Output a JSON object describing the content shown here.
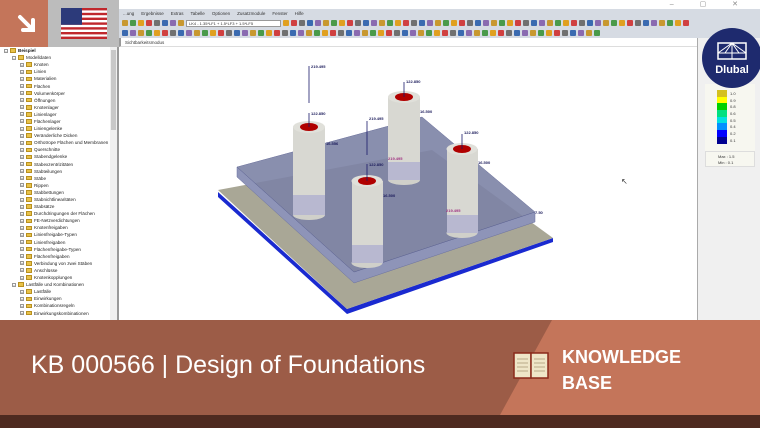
{
  "menu": [
    "...ung",
    "Ergebnisse",
    "Extras",
    "Tabelle",
    "Optionen",
    "Zusatzmodule",
    "Fenster",
    "Hilfe"
  ],
  "window_controls": "– ▢ ✕",
  "load_combo": "LK4 - 1.35*LF1 + 1.5*LF3 + 1.5*LF5",
  "view_mode": "Sichtbarkeitsmodus",
  "tree": [
    {
      "label": "Beispiel",
      "level": 0,
      "bold": true
    },
    {
      "label": "Modelldaten",
      "level": 1
    },
    {
      "label": "Knoten",
      "level": 2
    },
    {
      "label": "Linien",
      "level": 2
    },
    {
      "label": "Materialien",
      "level": 2
    },
    {
      "label": "Flächen",
      "level": 2
    },
    {
      "label": "Volumenkörper",
      "level": 2
    },
    {
      "label": "Öffnungen",
      "level": 2
    },
    {
      "label": "Knotenlager",
      "level": 2
    },
    {
      "label": "Linienlager",
      "level": 2
    },
    {
      "label": "Flächenlager",
      "level": 2
    },
    {
      "label": "Liniengelenke",
      "level": 2
    },
    {
      "label": "Veränderliche Dicken",
      "level": 2
    },
    {
      "label": "Orthotrope Flächen und Membranen",
      "level": 2
    },
    {
      "label": "Querschnitte",
      "level": 2
    },
    {
      "label": "Stabendgelenke",
      "level": 2
    },
    {
      "label": "Stabexzentrizitäten",
      "level": 2
    },
    {
      "label": "Stabteilungen",
      "level": 2
    },
    {
      "label": "Stäbe",
      "level": 2
    },
    {
      "label": "Rippen",
      "level": 2
    },
    {
      "label": "Stabbettungen",
      "level": 2
    },
    {
      "label": "Stabnichtlinearitäten",
      "level": 2
    },
    {
      "label": "Stabsätze",
      "level": 2
    },
    {
      "label": "Durchdringungen der Flächen",
      "level": 2
    },
    {
      "label": "FE-Netzverdichtungen",
      "level": 2
    },
    {
      "label": "Knotenfreigaben",
      "level": 2
    },
    {
      "label": "Linienfreigabe-Typen",
      "level": 2
    },
    {
      "label": "Linienfreigaben",
      "level": 2
    },
    {
      "label": "Flächenfreigabe-Typen",
      "level": 2
    },
    {
      "label": "Flächenfreigaben",
      "level": 2
    },
    {
      "label": "Verbindung von zwei Stäben",
      "level": 2
    },
    {
      "label": "Anschlüsse",
      "level": 2
    },
    {
      "label": "Knotenkopplungen",
      "level": 2
    },
    {
      "label": "Lastfälle und Kombinationen",
      "level": 1
    },
    {
      "label": "Lastfälle",
      "level": 2
    },
    {
      "label": "Einwirkungen",
      "level": 2
    },
    {
      "label": "Kombinationsregeln",
      "level": 2
    },
    {
      "label": "Einwirkungskombinationen",
      "level": 2
    }
  ],
  "model_labels": {
    "load_top": "219.495",
    "col1": "122.850",
    "col2": "122.850",
    "col3": "122.850",
    "col4": "122.850",
    "mid_load": "219.495",
    "dim1": "16.556",
    "dim2": "16.500",
    "dim3": "16.500",
    "dim4": "16.500",
    "mag1": "219.495",
    "mag2": "219.495",
    "edge": "7.50"
  },
  "legend": {
    "items": [
      {
        "v": "1.0",
        "c": "#d4c020"
      },
      {
        "v": "0.9",
        "c": "#ffff00"
      },
      {
        "v": "0.8",
        "c": "#00d000"
      },
      {
        "v": "0.6",
        "c": "#00e080"
      },
      {
        "v": "0.5",
        "c": "#00e0e0"
      },
      {
        "v": "0.4",
        "c": "#0090ff"
      },
      {
        "v": "0.2",
        "c": "#0000ff"
      },
      {
        "v": "0.1",
        "c": "#000090"
      }
    ],
    "max": "Max :  1.5",
    "min": "Min :  0.1"
  },
  "brand": "Dlubal",
  "banner": {
    "title": "KB 000566 | Design of Foundations",
    "label_line1": "KNOWLEDGE",
    "label_line2": "BASE"
  }
}
